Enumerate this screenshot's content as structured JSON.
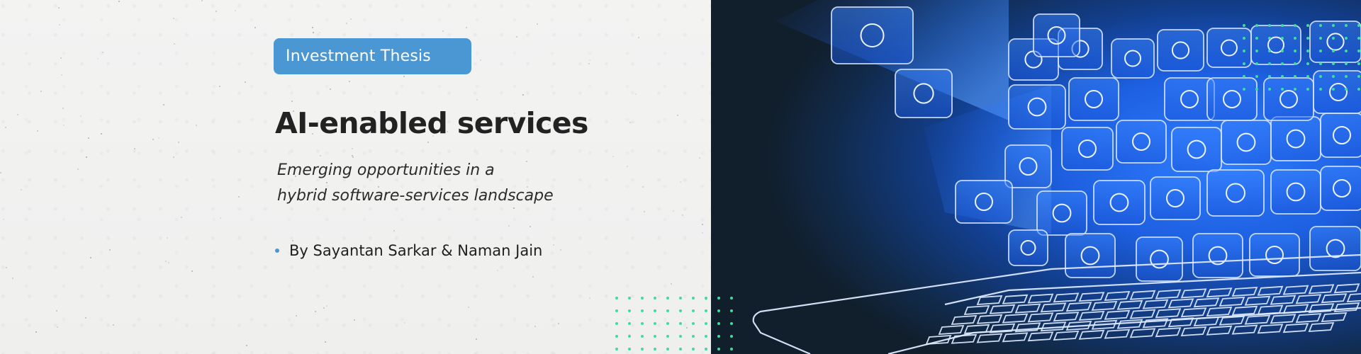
{
  "slide": {
    "badge_label": "Investment Thesis",
    "title": "AI-enabled services",
    "subtitle_line1": "Emerging opportunities in a",
    "subtitle_line2": "hybrid software-services landscape",
    "bullets": [
      {
        "text": "By Sayantan Sarkar & Naman Jain"
      }
    ]
  },
  "colors": {
    "accent_blue": "#4b97d3",
    "dot_green": "#3fdc9e",
    "text_dark": "#222223",
    "background": "#f1f1f0",
    "image_dark": "#111e2b",
    "image_glow": "#1f6bff"
  },
  "hero_image": {
    "description": "Glowing blue cubes with app icons rising out of a laptop keyboard",
    "icons": [
      "growth-chart-icon",
      "graduation-cap-icon",
      "camera-icon",
      "download-icon",
      "calendar-icon",
      "folder-icon",
      "phone-icon",
      "chat-icon",
      "game-controller-icon",
      "location-pin-icon",
      "briefcase-icon",
      "gears-icon",
      "music-note-icon",
      "shopping-cart-icon",
      "video-icon",
      "home-icon",
      "wifi-icon",
      "search-icon",
      "mail-icon",
      "people-icon"
    ]
  }
}
